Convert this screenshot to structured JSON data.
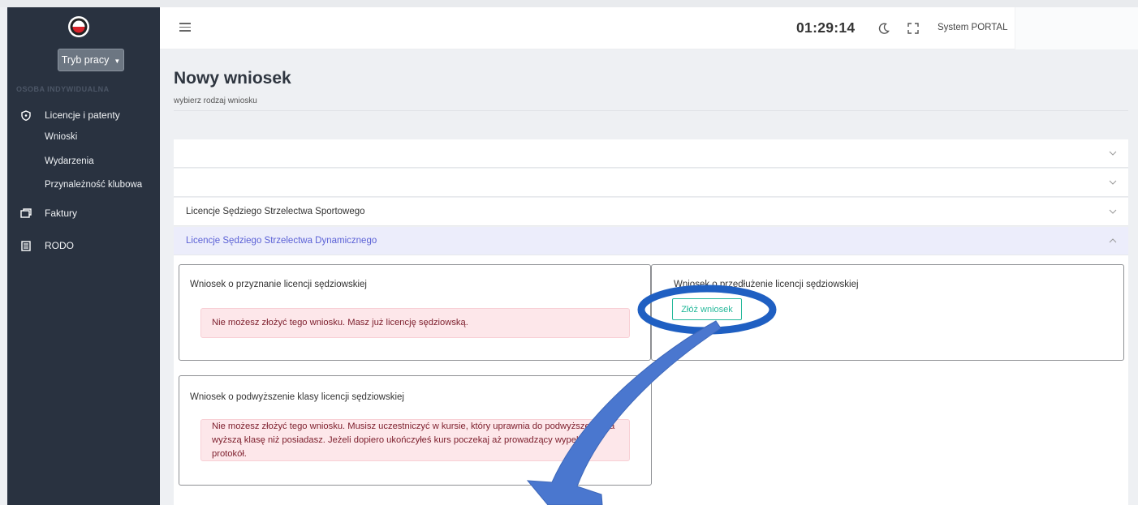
{
  "sidebar": {
    "mode_button": "Tryb pracy",
    "section_label": "OSOBA INDYWIDUALNA",
    "items": [
      {
        "label": "Licencje i patenty",
        "icon": "shield-icon"
      },
      {
        "label": "Faktury",
        "icon": "invoice-icon"
      },
      {
        "label": "RODO",
        "icon": "document-icon"
      }
    ],
    "subitems": [
      "Wnioski",
      "Wydarzenia",
      "Przynależność klubowa"
    ]
  },
  "header": {
    "clock": "01:29:14",
    "system_label": "System PORTAL"
  },
  "main": {
    "title": "Nowy wniosek",
    "subtitle": "wybierz rodzaj wniosku",
    "accordion": [
      {
        "label": ""
      },
      {
        "label": ""
      },
      {
        "label": "Licencje Sędziego Strzelectwa Sportowego"
      },
      {
        "label": "Licencje Sędziego Strzelectwa Dynamicznego"
      }
    ],
    "cards": [
      {
        "title": "Wniosek o przyznanie licencji sędziowskiej",
        "alert": "Nie możesz złożyć tego wniosku. Masz już licencję sędziowską."
      },
      {
        "title": "Wniosek o przedłużenie licencji sędziowskiej",
        "button": "Złóż wniosek"
      },
      {
        "title": "Wniosek o podwyższenie klasy licencji sędziowskiej",
        "alert_line1": "Nie możesz złożyć tego wniosku. Musisz uczestniczyć w kursie, który uprawnia do podwyższenia na",
        "alert_line2": "wyższą klasę niż posiadasz. Jeżeli dopiero ukończyłeś kurs poczekaj aż prowadzący wypełni protokół."
      }
    ]
  },
  "colors": {
    "sidebar_bg": "#293240",
    "accent_active": "#5b61d6",
    "success": "#24b89a",
    "alert_bg": "#fde7ea",
    "annotation": "#3f70c8"
  }
}
